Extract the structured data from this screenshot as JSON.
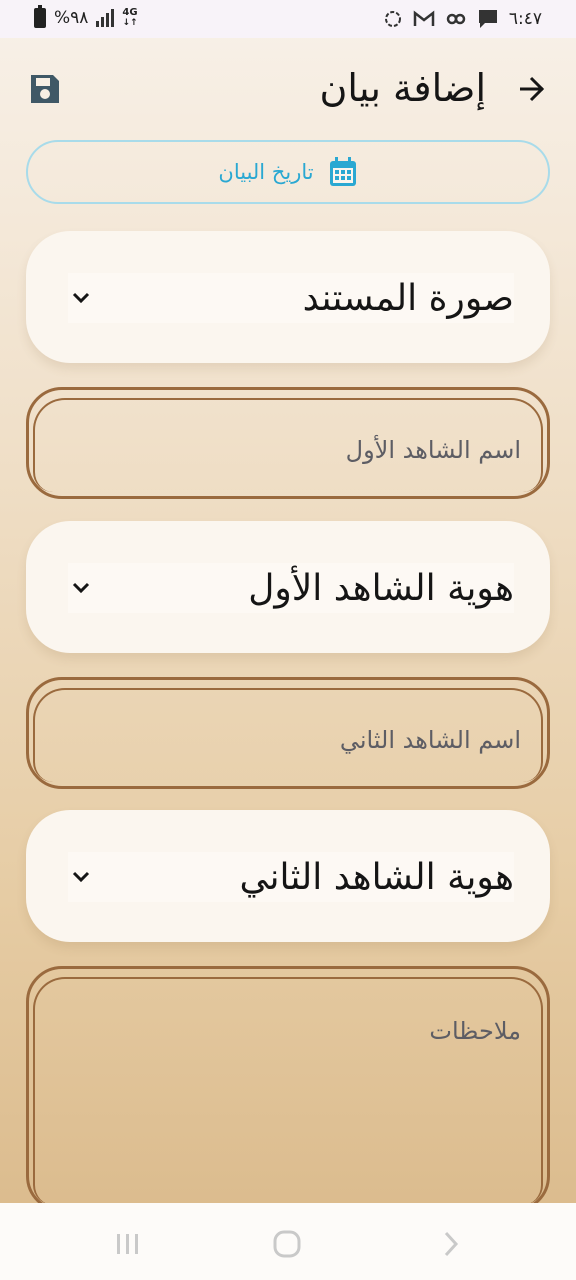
{
  "status_bar": {
    "time": "٦:٤٧",
    "battery_percent": "%٩٨",
    "network": "4G",
    "icons": [
      "battery-icon",
      "signal-icon",
      "network-4g-icon",
      "sync-icon",
      "gmail-icon",
      "link-icon",
      "message-icon"
    ]
  },
  "header": {
    "title": "إضافة بيان",
    "back_icon": "arrow-back-icon",
    "save_icon": "save-icon"
  },
  "date_button": {
    "label": "تاريخ البيان",
    "icon": "calendar-icon",
    "color": "#2aa8d2"
  },
  "form": {
    "document_image": {
      "label": "صورة المستند"
    },
    "first_witness_name": {
      "placeholder": "اسم الشاهد الأول"
    },
    "first_witness_id": {
      "label": "هوية الشاهد الأول"
    },
    "second_witness_name": {
      "placeholder": "اسم الشاهد الثاني"
    },
    "second_witness_id": {
      "label": "هوية الشاهد الثاني"
    },
    "notes": {
      "placeholder": "ملاحظات"
    }
  },
  "nav_bar": {
    "icons": [
      "recent-apps-icon",
      "home-icon",
      "back-icon"
    ]
  },
  "colors": {
    "border_brown": "#9a6a3e",
    "card_bg": "#fbf6ef",
    "accent_blue": "#2aa8d2"
  }
}
